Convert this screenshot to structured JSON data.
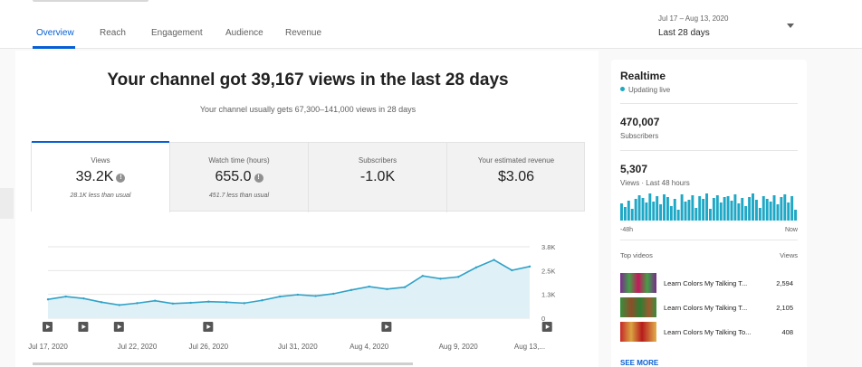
{
  "tabs": [
    {
      "label": "Overview",
      "active": true
    },
    {
      "label": "Reach"
    },
    {
      "label": "Engagement"
    },
    {
      "label": "Audience"
    },
    {
      "label": "Revenue"
    }
  ],
  "date_picker": {
    "range": "Jul 17 – Aug 13, 2020",
    "label": "Last 28 days"
  },
  "overview": {
    "headline": "Your channel got 39,167 views in the last 28 days",
    "subline": "Your channel usually gets 67,300–141,000 views in 28 days"
  },
  "metrics": [
    {
      "label": "Views",
      "value": "39.2K",
      "note": "28.1K less than usual"
    },
    {
      "label": "Watch time (hours)",
      "value": "655.0",
      "note": "451.7 less than usual"
    },
    {
      "label": "Subscribers",
      "value": "-1.0K"
    },
    {
      "label": "Your estimated revenue",
      "value": "$3.06"
    }
  ],
  "chart_data": {
    "type": "area",
    "x": [
      "Jul 17",
      "Jul 18",
      "Jul 19",
      "Jul 20",
      "Jul 21",
      "Jul 22",
      "Jul 23",
      "Jul 24",
      "Jul 25",
      "Jul 26",
      "Jul 27",
      "Jul 28",
      "Jul 29",
      "Jul 30",
      "Jul 31",
      "Aug 1",
      "Aug 2",
      "Aug 3",
      "Aug 4",
      "Aug 5",
      "Aug 6",
      "Aug 7",
      "Aug 8",
      "Aug 9",
      "Aug 10",
      "Aug 11",
      "Aug 12",
      "Aug 13"
    ],
    "series": [
      {
        "values": [
          1000,
          1150,
          1050,
          850,
          700,
          800,
          930,
          780,
          820,
          880,
          850,
          800,
          950,
          1150,
          1250,
          1180,
          1300,
          1500,
          1680,
          1550,
          1650,
          2250,
          2100,
          2200,
          2700,
          3100,
          2550,
          2750
        ]
      }
    ],
    "ylim": [
      0,
      3800
    ],
    "y_ticks": [
      "3.8K",
      "2.5K",
      "1.3K",
      "0"
    ],
    "x_ticks": [
      "Jul 17, 2020",
      "Jul 22, 2020",
      "Jul 26, 2020",
      "Jul 31, 2020",
      "Aug 4, 2020",
      "Aug 9, 2020",
      "Aug 13,..."
    ],
    "x_tick_index": [
      0,
      5,
      9,
      14,
      18,
      23,
      27
    ],
    "marker_days": [
      0,
      2,
      4,
      9,
      19,
      28
    ],
    "color": "#31a2c7",
    "fill": "#dff1f7",
    "grid": true
  },
  "realtime": {
    "title": "Realtime",
    "status": "Updating live",
    "subscribers_value": "470,007",
    "subscribers_label": "Subscribers",
    "views_value": "5,307",
    "views_label": "Views · Last 48 hours",
    "axis_start": "-48h",
    "axis_end": "Now",
    "hourly_views": [
      95,
      75,
      110,
      65,
      120,
      140,
      125,
      100,
      150,
      105,
      135,
      90,
      145,
      130,
      80,
      120,
      60,
      145,
      105,
      115,
      140,
      70,
      135,
      120,
      150,
      65,
      125,
      140,
      100,
      130,
      135,
      110,
      145,
      95,
      125,
      80,
      130,
      150,
      115,
      70,
      135,
      120,
      105,
      140,
      90,
      130,
      145,
      100,
      135,
      60
    ],
    "bar_color": "#1fa8c6",
    "top_videos_label": "Top videos",
    "views_col": "Views",
    "videos": [
      {
        "title": "Learn Colors My Talking T...",
        "views": "2,594"
      },
      {
        "title": "Learn Colors My Talking T...",
        "views": "2,105"
      },
      {
        "title": "Learn Colors My Talking To...",
        "views": "408"
      }
    ],
    "see_more": "SEE MORE"
  }
}
